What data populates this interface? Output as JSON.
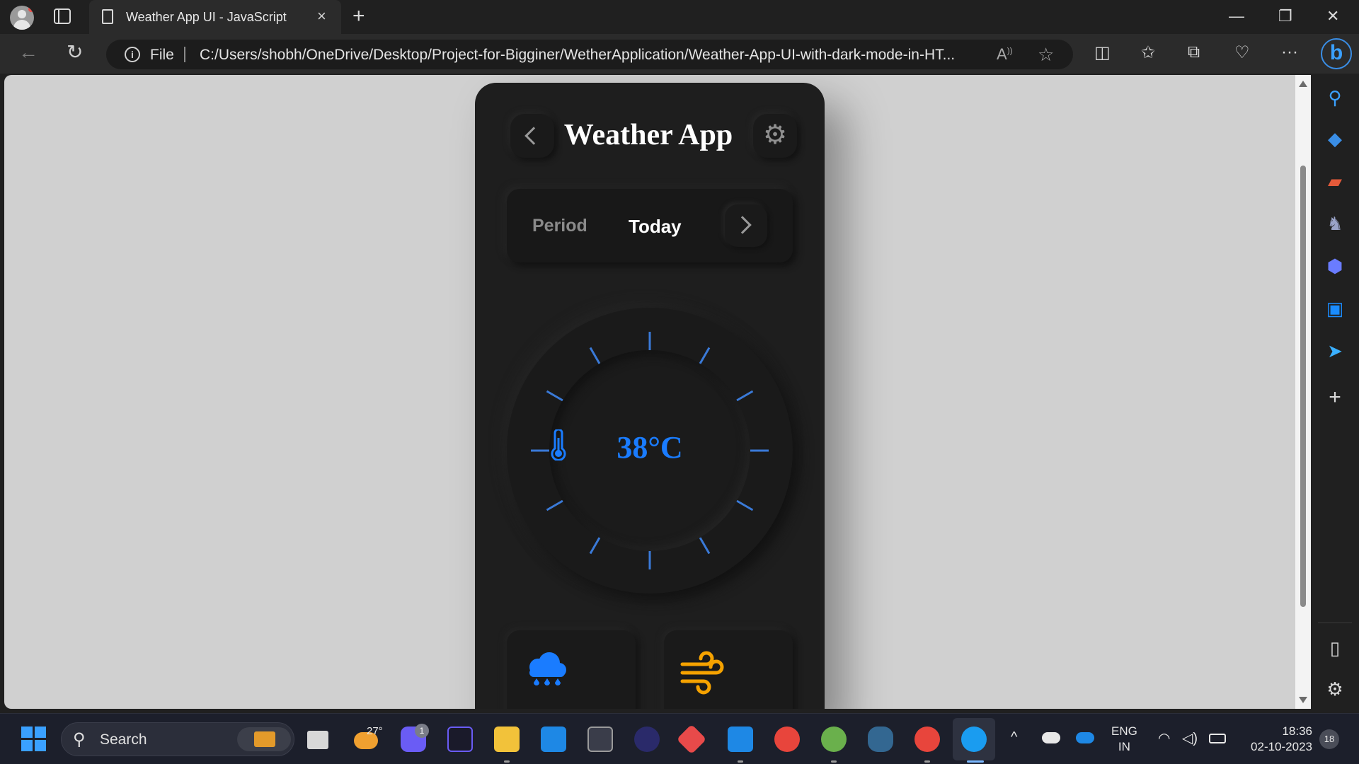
{
  "browser": {
    "tab_title": "Weather App UI - JavaScript",
    "tab_close": "×",
    "new_tab": "+",
    "window_controls": {
      "minimize": "—",
      "maximize": "❐",
      "close": "✕"
    },
    "address": {
      "scheme_label": "File",
      "url": "C:/Users/shobh/OneDrive/Desktop/Project-for-Bigginer/WetherApplication/Weather-App-UI-with-dark-mode-in-HT..."
    },
    "nav": {
      "back": "←",
      "reload": "↻"
    },
    "toolbar": {
      "read_aloud": "Aͅ",
      "favorite": "☆",
      "split": "◫",
      "favorites": "✩",
      "collections": "⧉",
      "health": "♡",
      "more": "···",
      "copilot": "b"
    },
    "sidebar_icons": [
      "search-icon",
      "shopping-icon",
      "tools-icon",
      "games-icon",
      "office-icon",
      "outlook-icon",
      "send-icon",
      "add-icon",
      "panel-icon",
      "settings-icon"
    ]
  },
  "app": {
    "title": "Weather App",
    "period_label": "Period",
    "period_value": "Today",
    "temperature": "38°C",
    "accent_color": "#1a7cff",
    "wind_color": "#f5a200"
  },
  "taskbar": {
    "search_placeholder": "Search",
    "weather_temp": "27°",
    "teams_badge": "1",
    "language": "ENG",
    "region": "IN",
    "time": "18:36",
    "date": "02-10-2023",
    "notifications": "18"
  }
}
